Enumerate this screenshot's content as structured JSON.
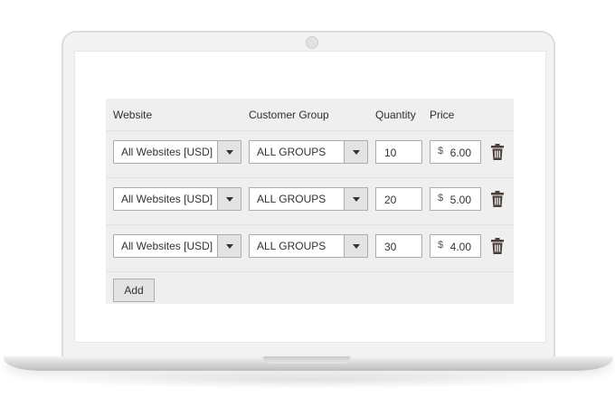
{
  "table": {
    "headers": {
      "website": "Website",
      "customer_group": "Customer Group",
      "quantity": "Quantity",
      "price": "Price"
    },
    "rows": [
      {
        "website": "All Websites [USD]",
        "group": "ALL GROUPS",
        "quantity": "10",
        "currency": "$",
        "price": "6.00"
      },
      {
        "website": "All Websites [USD]",
        "group": "ALL GROUPS",
        "quantity": "20",
        "currency": "$",
        "price": "5.00"
      },
      {
        "website": "All Websites [USD]",
        "group": "ALL GROUPS",
        "quantity": "30",
        "currency": "$",
        "price": "4.00"
      }
    ],
    "add_label": "Add"
  },
  "icons": {
    "delete": "trash-icon",
    "dropdown": "chevron-down-icon"
  },
  "colors": {
    "panel_bg": "#efefef",
    "trash": "#4a3f3a"
  }
}
